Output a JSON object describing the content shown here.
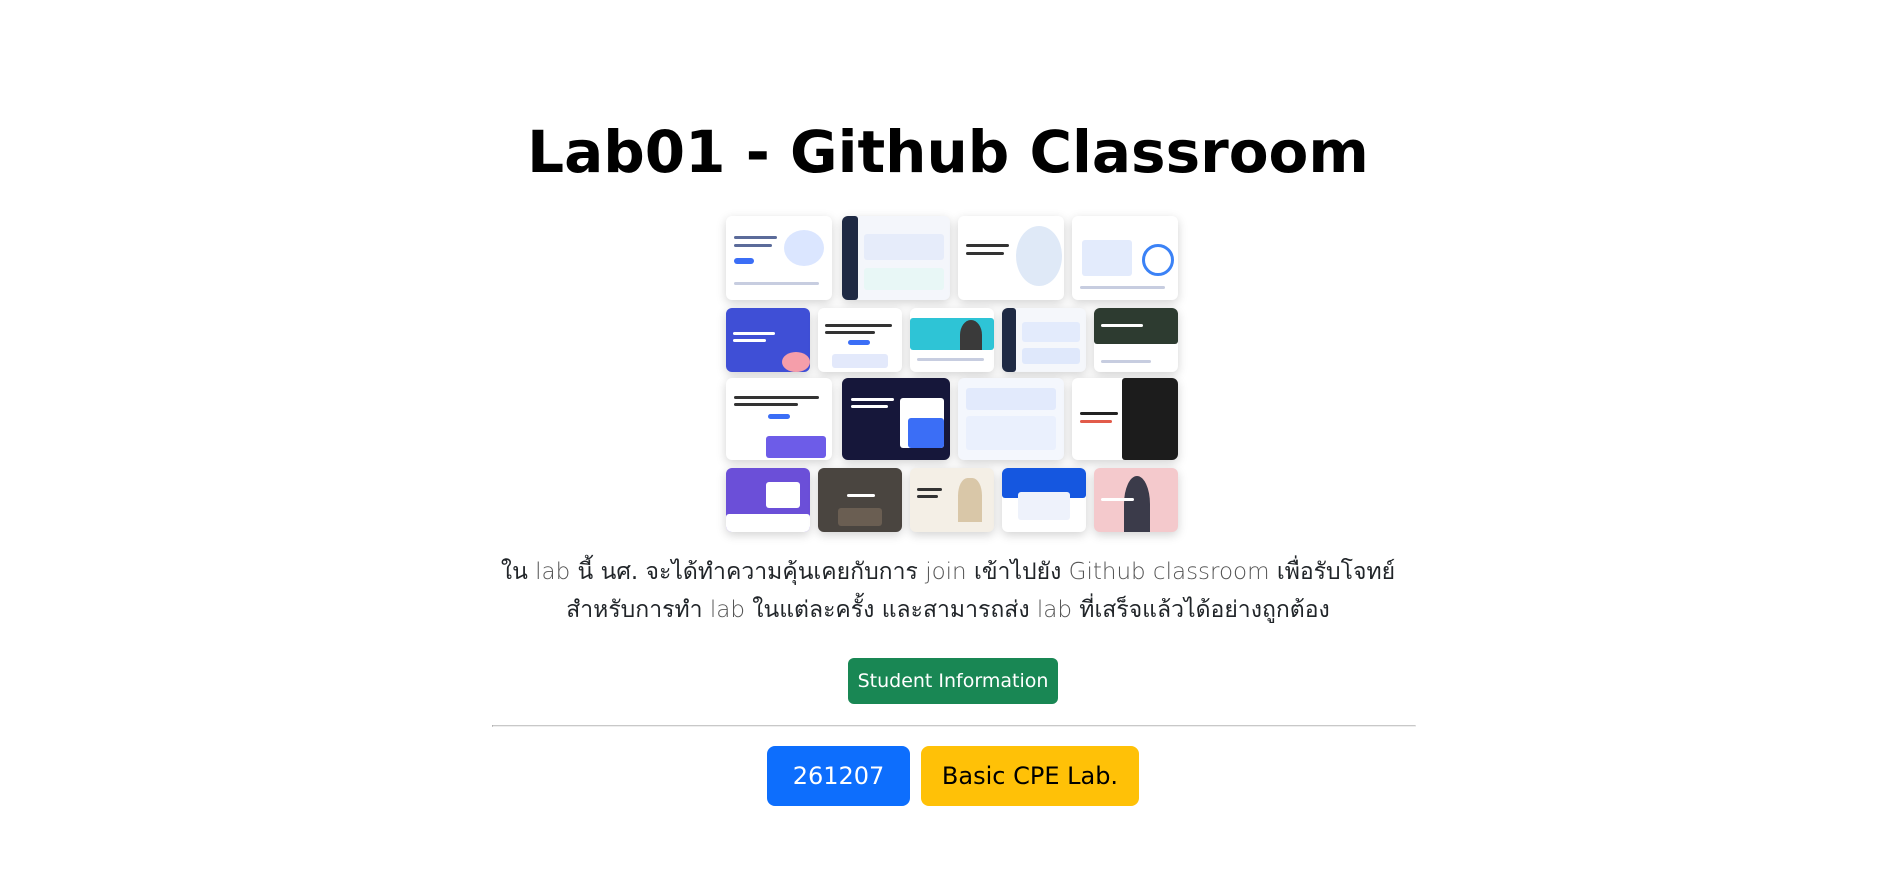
{
  "page": {
    "title": "Lab01 - Github Classroom",
    "hero_image_alt": "website templates collage"
  },
  "description": {
    "line1": [
      {
        "text": "ใน ",
        "weight": "normal"
      },
      {
        "text": "lab",
        "weight": "light"
      },
      {
        "text": " นี้ นศ. จะได้ทำความคุ้นเคยกับการ ",
        "weight": "normal"
      },
      {
        "text": "join",
        "weight": "light"
      },
      {
        "text": " เข้าไปยัง ",
        "weight": "normal"
      },
      {
        "text": "Github classroom",
        "weight": "light"
      },
      {
        "text": " เพื่อรับโจทย์",
        "weight": "normal"
      }
    ],
    "line2": [
      {
        "text": "สำหรับการทำ ",
        "weight": "normal"
      },
      {
        "text": "lab",
        "weight": "light"
      },
      {
        "text": " ในแต่ละครั้ง และสามารถส่ง ",
        "weight": "normal"
      },
      {
        "text": "lab",
        "weight": "light"
      },
      {
        "text": " ที่เสร็จแล้วได้อย่างถูกต้อง",
        "weight": "normal"
      }
    ]
  },
  "actions": {
    "student_info_label": "Student Information"
  },
  "course": {
    "code": "261207",
    "name": "Basic CPE Lab."
  },
  "colors": {
    "success": "#198754",
    "primary": "#0d6efd",
    "warning": "#ffc107"
  }
}
